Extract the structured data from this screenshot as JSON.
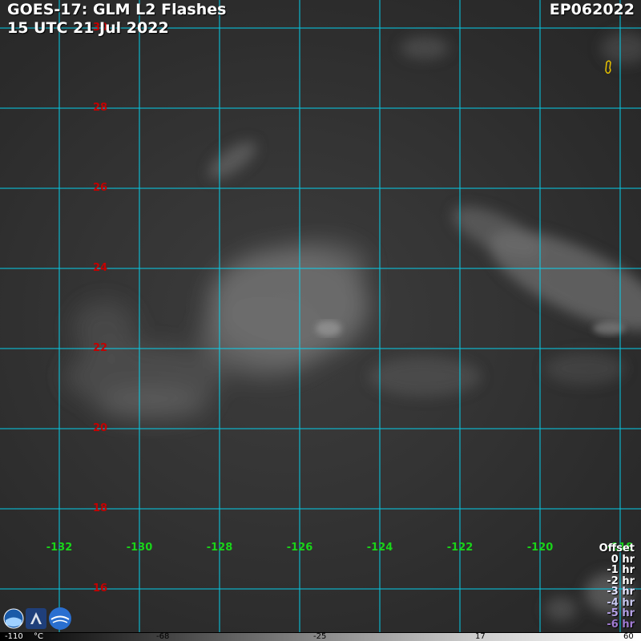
{
  "header": {
    "title_line1": "GOES-17: GLM L2 Flashes",
    "title_line2": "15 UTC 21 Jul 2022",
    "storm_id": "EP062022"
  },
  "map": {
    "latitude_labels": [
      "30",
      "28",
      "26",
      "24",
      "22",
      "20",
      "18",
      "16"
    ],
    "longitude_labels": [
      "-132",
      "-130",
      "-128",
      "-126",
      "-124",
      "-122",
      "-120",
      "-118"
    ],
    "grid_color": "#00e0ff",
    "latitude_label_color": "#c40000",
    "longitude_label_color": "#19d419"
  },
  "legend": {
    "title": "Offset",
    "items": [
      {
        "label": "0 hr",
        "color": "#ffffff"
      },
      {
        "label": "-1 hr",
        "color": "#ffffff"
      },
      {
        "label": "-2 hr",
        "color": "#ffffff"
      },
      {
        "label": "-3 hr",
        "color": "#e4e4ff"
      },
      {
        "label": "-4 hr",
        "color": "#c8c8f0"
      },
      {
        "label": "-5 hr",
        "color": "#b4a0e6"
      },
      {
        "label": "-6 hr",
        "color": "#a07ad2"
      }
    ]
  },
  "colorbar": {
    "labels": [
      "-110",
      "°C",
      "-68",
      "-25",
      "17",
      "60"
    ]
  },
  "logos": [
    "noaa-logo",
    "cira-logo",
    "rammb-logo"
  ]
}
